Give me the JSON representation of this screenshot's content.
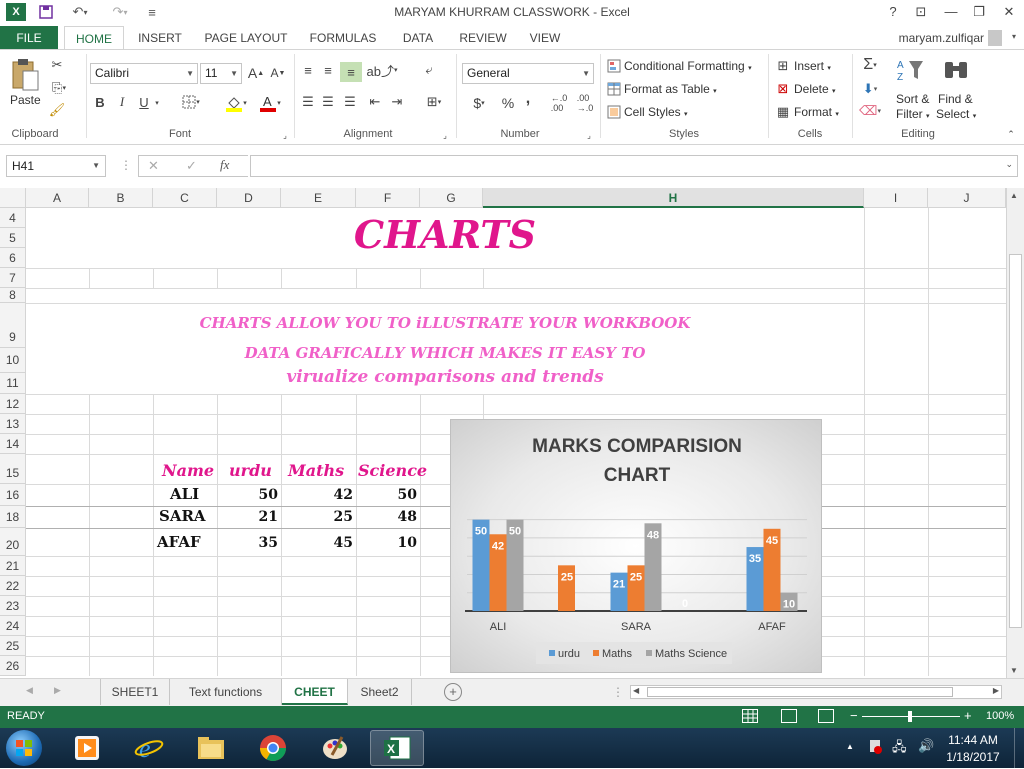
{
  "window": {
    "title": "MARYAM KHURRAM CLASSWORK - Excel",
    "help": "?",
    "minimize": "—",
    "maximize": "❐",
    "close": "✕"
  },
  "quick_access": {
    "save_icon": "save-icon",
    "undo_icon": "undo-icon",
    "redo_icon": "redo-icon"
  },
  "tabs": {
    "file": "FILE",
    "items": [
      "HOME",
      "INSERT",
      "PAGE LAYOUT",
      "FORMULAS",
      "DATA",
      "REVIEW",
      "VIEW"
    ],
    "user": "maryam.zulfiqar"
  },
  "ribbon": {
    "clipboard": {
      "label": "Clipboard",
      "paste": "Paste"
    },
    "font": {
      "label": "Font",
      "name": "Calibri",
      "size": "11",
      "bold": "B",
      "italic": "I",
      "underline": "U"
    },
    "alignment": {
      "label": "Alignment"
    },
    "number": {
      "label": "Number",
      "format": "General",
      "currency": "$",
      "percent": "%",
      "comma": ","
    },
    "styles": {
      "label": "Styles",
      "conditional": "Conditional Formatting",
      "table": "Format as Table",
      "cell_styles": "Cell Styles"
    },
    "cells": {
      "label": "Cells",
      "insert": "Insert",
      "delete": "Delete",
      "format": "Format"
    },
    "editing": {
      "label": "Editing",
      "sort": "Sort &",
      "filter": "Filter",
      "find": "Find &",
      "select": "Select"
    }
  },
  "formula_bar": {
    "name_box": "H41",
    "cancel": "✕",
    "enter": "✓",
    "fx": "fx",
    "value": ""
  },
  "columns": [
    "A",
    "B",
    "C",
    "D",
    "E",
    "F",
    "G",
    "H",
    "I",
    "J"
  ],
  "selected_column": "H",
  "rows": [
    "4",
    "5",
    "6",
    "7",
    "8",
    "9",
    "10",
    "11",
    "12",
    "13",
    "14",
    "15",
    "16",
    "18",
    "20",
    "21",
    "22",
    "23",
    "24",
    "25",
    "26"
  ],
  "sheet": {
    "title": "CHARTS",
    "desc_line1": "CHARTS ALLOW YOU TO iLLUSTRATE YOUR WORKBOOK",
    "desc_line2": "DATA GRAFICALLY WHICH MAKES IT EASY TO",
    "desc_line3": "virualize comparisons and trends",
    "table_headers": [
      "Name",
      "urdu",
      "Maths",
      "Science"
    ],
    "table_rows": [
      {
        "name": "ALI",
        "urdu": "50",
        "maths": "42",
        "science": "50"
      },
      {
        "name": "SARA",
        "urdu": "21",
        "maths": "25",
        "science": "48"
      },
      {
        "name": "AFAF",
        "urdu": "35",
        "maths": "45",
        "science": "10"
      }
    ]
  },
  "chart_data": {
    "type": "bar",
    "title": "MARKS COMPARISION CHART",
    "categories": [
      "ALI",
      "SARA",
      "AFAF"
    ],
    "series": [
      {
        "name": "urdu",
        "values": [
          50,
          21,
          35
        ],
        "color": "#5b9bd5"
      },
      {
        "name": "Maths",
        "values": [
          42,
          25,
          45
        ],
        "color": "#ed7d31"
      },
      {
        "name": "Maths Science",
        "values": [
          50,
          48,
          10
        ],
        "color": "#a5a5a5"
      }
    ],
    "extra_labels": [
      {
        "text": "25",
        "color": "#ed7d31",
        "value": 25
      },
      {
        "text": "0",
        "value": 0
      }
    ],
    "ylim": [
      0,
      52
    ],
    "legend": "bottom",
    "grid": true
  },
  "sheet_tabs": [
    "SHEET1",
    "Text functions",
    "CHEET",
    "Sheet2"
  ],
  "active_sheet": "CHEET",
  "status": {
    "ready": "READY",
    "zoom": "100%"
  },
  "taskbar": {
    "time": "11:44 AM",
    "date": "1/18/2017"
  }
}
